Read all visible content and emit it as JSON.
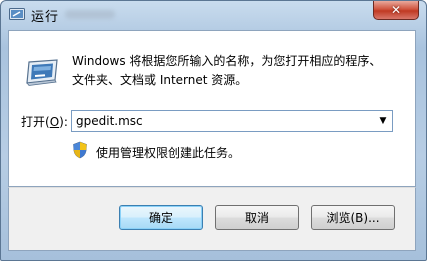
{
  "window": {
    "title": "运行"
  },
  "dialog": {
    "description_line1": "Windows 将根据您所输入的名称，为您打开相应的程序、",
    "description_line2": "文件夹、文档或 Internet 资源。",
    "open_label_prefix": "打开(",
    "open_label_hotkey": "O",
    "open_label_suffix": "):",
    "open_value": "gpedit.msc",
    "admin_note": "使用管理权限创建此任务。"
  },
  "buttons": {
    "ok": "确定",
    "cancel": "取消",
    "browse": "浏览(B)..."
  },
  "icons": {
    "title": "run-app-icon",
    "main": "run-dialog-icon",
    "shield": "uac-shield-icon",
    "dropdown": "chevron-down-icon",
    "close": "close-icon"
  },
  "colors": {
    "close_button": "#c8432c",
    "default_button_border": "#3c7fb1",
    "footer_background": "#f0f0f0"
  }
}
